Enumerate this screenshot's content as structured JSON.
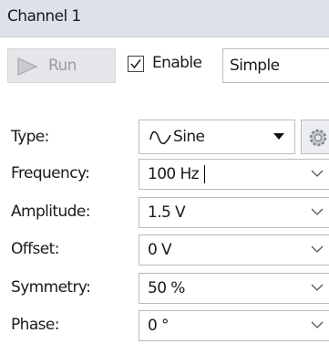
{
  "panel": {
    "title": "Channel 1"
  },
  "toolbar": {
    "run_label": "Run",
    "enable_label": "Enable",
    "enable_checked": true,
    "mode_value": "Simple"
  },
  "type_row": {
    "label": "Type:",
    "value": "Sine",
    "icon": "sine-wave-icon"
  },
  "fields": {
    "frequency": {
      "label": "Frequency:",
      "value": "100 Hz"
    },
    "amplitude": {
      "label": "Amplitude:",
      "value": "1.5 V"
    },
    "offset": {
      "label": "Offset:",
      "value": "0 V"
    },
    "symmetry": {
      "label": "Symmetry:",
      "value": "50 %"
    },
    "phase": {
      "label": "Phase:",
      "value": "0 °"
    }
  },
  "colors": {
    "titlebar_bg": "#dde1ea",
    "disabled_button_bg": "#e5e6e9",
    "disabled_text": "#9a9da3",
    "field_border": "#b9bcc2"
  }
}
